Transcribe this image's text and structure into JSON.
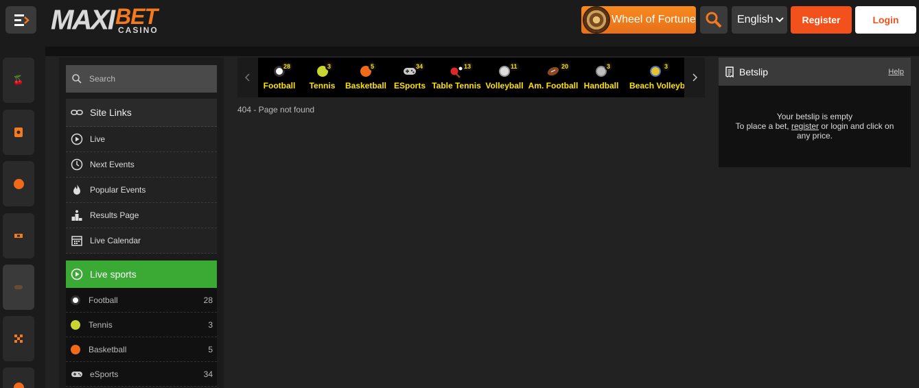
{
  "header": {
    "logo_main": "MAXI",
    "logo_accent": "BET",
    "logo_sub": "CASINO",
    "wheel_label": "Wheel of Fortune",
    "language": "English",
    "register_label": "Register",
    "login_label": "Login"
  },
  "rail": {
    "items": [
      {
        "icon": "cherry-icon"
      },
      {
        "icon": "cards-icon"
      },
      {
        "icon": "basketball-icon"
      },
      {
        "icon": "ticket-icon"
      },
      {
        "icon": "gamepad-icon"
      },
      {
        "icon": "checkered-flag-icon"
      },
      {
        "icon": "basketball-icon"
      }
    ]
  },
  "sidebar": {
    "search_placeholder": "Search",
    "site_links_title": "Site Links",
    "links": [
      {
        "label": "Live",
        "icon": "play-circle-icon"
      },
      {
        "label": "Next Events",
        "icon": "clock-icon"
      },
      {
        "label": "Popular Events",
        "icon": "flame-icon"
      },
      {
        "label": "Results Page",
        "icon": "podium-icon"
      },
      {
        "label": "Live Calendar",
        "icon": "calendar-icon"
      }
    ],
    "live_sports_title": "Live sports",
    "live_sports": [
      {
        "name": "Football",
        "count": "28",
        "color": "#ffffff"
      },
      {
        "name": "Tennis",
        "count": "3",
        "color": "#c8d630"
      },
      {
        "name": "Basketball",
        "count": "5",
        "color": "#f06a1a"
      },
      {
        "name": "eSports",
        "count": "34",
        "color": "#bbbbbb"
      }
    ]
  },
  "sports_bar": {
    "items": [
      {
        "name": "Football",
        "count": "28",
        "color": "#ffffff"
      },
      {
        "name": "Tennis",
        "count": "3",
        "color": "#c8d630"
      },
      {
        "name": "Basketball",
        "count": "5",
        "color": "#f06a1a"
      },
      {
        "name": "ESports",
        "count": "34",
        "color": "#cccccc"
      },
      {
        "name": "Table Tennis",
        "count": "13",
        "color": "#e0262b"
      },
      {
        "name": "Volleyball",
        "count": "11",
        "color": "#dddddd"
      },
      {
        "name": "Am. Football",
        "count": "20",
        "color": "#8b4a24"
      },
      {
        "name": "Handball",
        "count": "3",
        "color": "#bfbfbf"
      },
      {
        "name": "Beach Volleyball",
        "count": "3",
        "color": "#e8c22a"
      }
    ]
  },
  "main": {
    "message": "404 - Page not found"
  },
  "betslip": {
    "title": "Betslip",
    "help": "Help",
    "empty": "Your betslip is empty",
    "line_pre": "To place a bet,",
    "register_link": "register",
    "line_post": "or login and click on any price."
  },
  "colors": {
    "accent": "#f47a1f",
    "register": "#f2511b",
    "live_green": "#3aaa35",
    "sport_label": "#ffe400"
  }
}
